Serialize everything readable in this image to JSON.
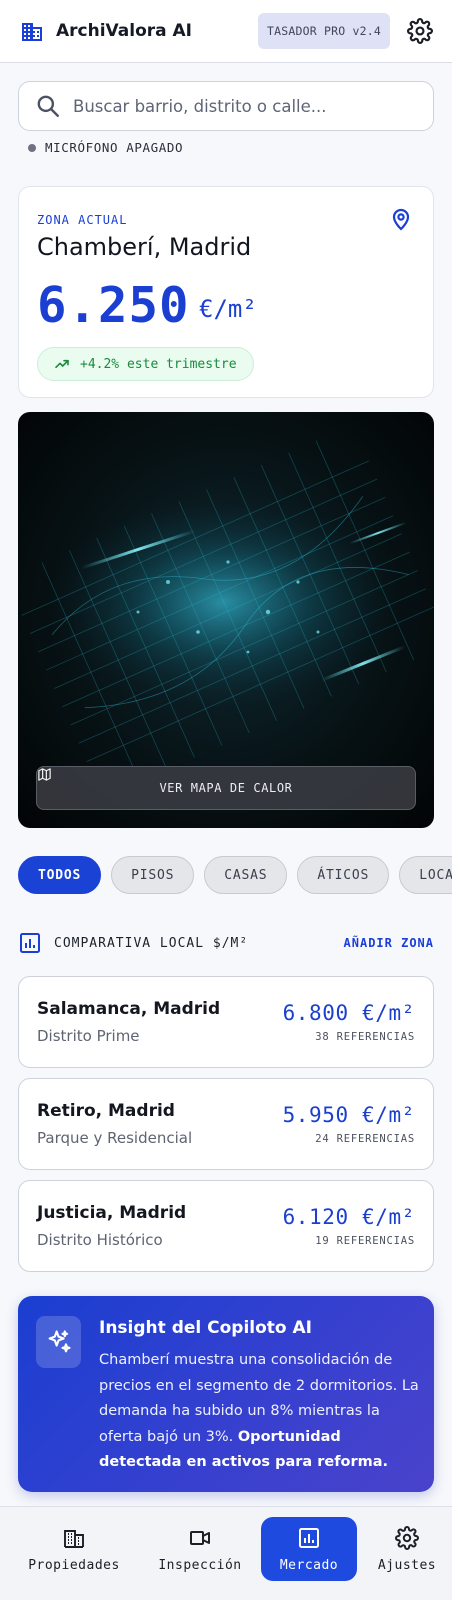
{
  "header": {
    "app_title": "ArchiValora AI",
    "version_badge": "TASADOR PRO v2.4"
  },
  "search": {
    "placeholder": "Buscar barrio, distrito o calle..."
  },
  "mic_status": "MICRÓFONO APAGADO",
  "zone_card": {
    "label": "ZONA ACTUAL",
    "name": "Chamberí, Madrid",
    "price": "6.250",
    "unit": "€/m²",
    "trend": "+4.2% este trimestre"
  },
  "map": {
    "button_label": "VER MAPA DE CALOR"
  },
  "filters": [
    "TODOS",
    "PISOS",
    "CASAS",
    "ÁTICOS",
    "LOCALES"
  ],
  "comparativa": {
    "title": "COMPARATIVA LOCAL $/M²",
    "add_label": "AÑADIR ZONA",
    "zones": [
      {
        "name": "Salamanca, Madrid",
        "subtitle": "Distrito Prime",
        "price": "6.800 €/m²",
        "refs": "38 REFERENCIAS"
      },
      {
        "name": "Retiro, Madrid",
        "subtitle": "Parque y Residencial",
        "price": "5.950 €/m²",
        "refs": "24 REFERENCIAS"
      },
      {
        "name": "Justicia, Madrid",
        "subtitle": "Distrito Histórico",
        "price": "6.120 €/m²",
        "refs": "19 REFERENCIAS"
      }
    ]
  },
  "insight": {
    "title": "Insight del Copiloto AI",
    "body": "Chamberí muestra una consolidación de precios en el segmento de 2 dormitorios. La demanda ha subido un 8% mientras la oferta bajó un 3%.",
    "highlight": "Oportunidad detectada en activos para reforma."
  },
  "nav": {
    "items": [
      {
        "label": "Propiedades",
        "icon": "building-icon"
      },
      {
        "label": "Inspección",
        "icon": "video-camera-icon"
      },
      {
        "label": "Mercado",
        "icon": "bar-chart-icon"
      },
      {
        "label": "Ajustes",
        "icon": "gear-icon"
      }
    ],
    "active": "Mercado"
  },
  "colors": {
    "accent": "#1a43d6",
    "trend_positive": "#1c8a3e",
    "insight_gradient_start": "#1a3fd1",
    "insight_gradient_end": "#4a43cc"
  }
}
